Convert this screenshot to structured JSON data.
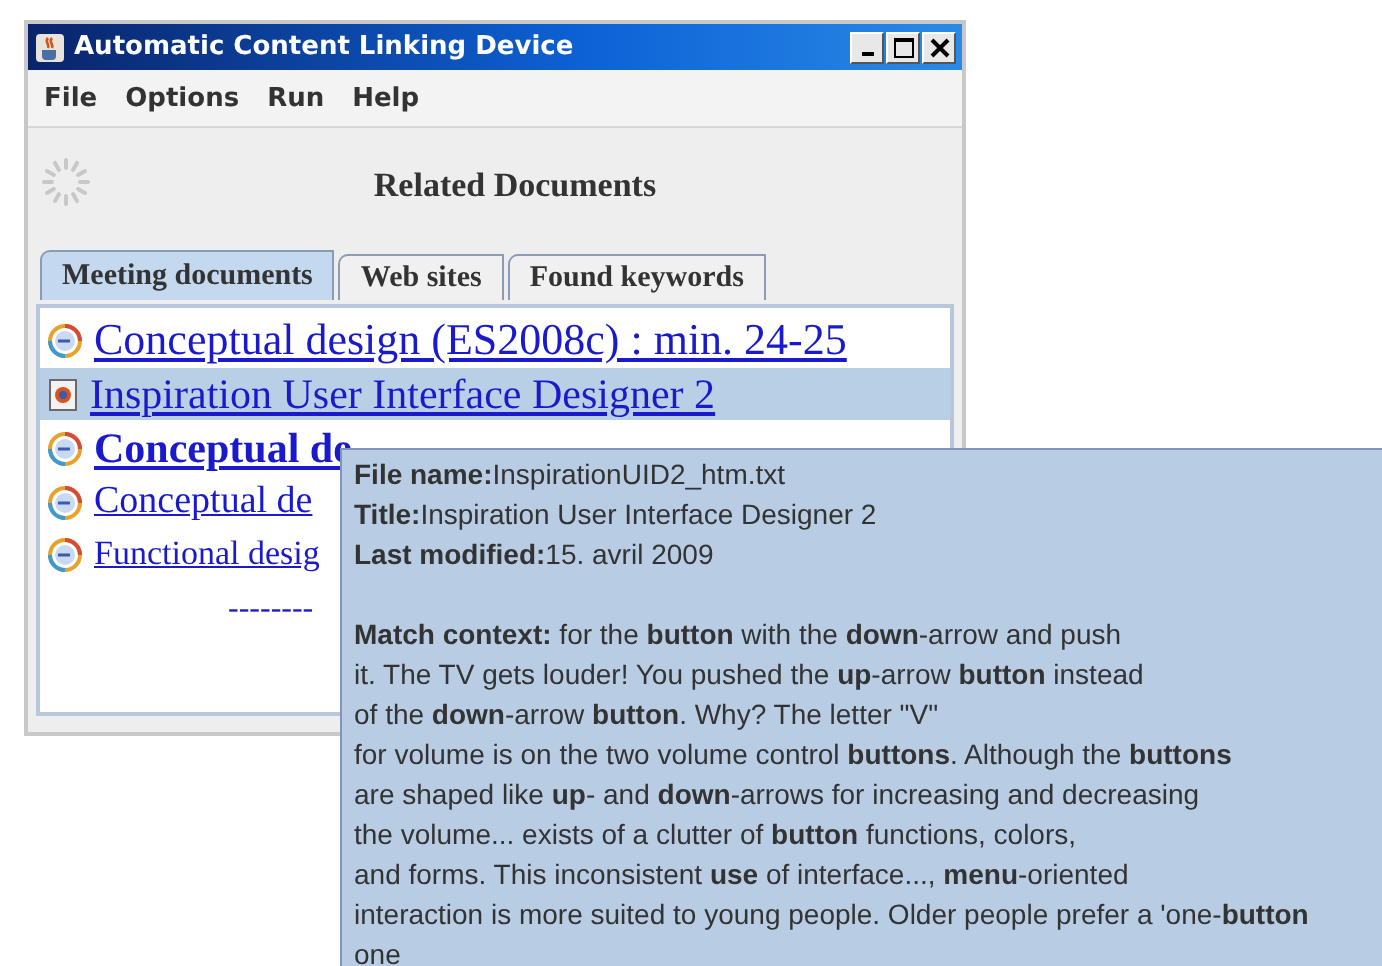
{
  "window": {
    "title": "Automatic Content Linking Device"
  },
  "menu": [
    "File",
    "Options",
    "Run",
    "Help"
  ],
  "heading": "Related Documents",
  "tabs": [
    {
      "label": "Meeting documents",
      "selected": true
    },
    {
      "label": "Web sites",
      "selected": false
    },
    {
      "label": "Found keywords",
      "selected": false
    }
  ],
  "documents": [
    {
      "kind": "meeting",
      "title": "Conceptual design (ES2008c) : min. 24-25",
      "selected": false
    },
    {
      "kind": "document",
      "title": "Inspiration User Interface Designer 2",
      "selected": true
    },
    {
      "kind": "meeting",
      "title": "Conceptual de",
      "selected": false
    },
    {
      "kind": "meeting",
      "title": "Conceptual de",
      "selected": false
    },
    {
      "kind": "meeting",
      "title": "Functional desig",
      "selected": false
    }
  ],
  "separator": "--------",
  "tooltip": {
    "lines": [
      "**File name:**InspirationUID2_htm.txt",
      "**Title:**Inspiration User Interface Designer 2",
      "**Last modified:**15. avril 2009"
    ],
    "context": [
      "**Match context:** for the **button** with the **down**-arrow and push",
      "it. The TV gets louder! You pushed the **up**-arrow **button** instead",
      "of the **down**-arrow **button**. Why? The letter \"V\"",
      "for volume is on the two volume control **buttons**. Although the **buttons**",
      "are shaped like **up**- and **down**-arrows for increasing and decreasing",
      "the volume... exists of a clutter of **button** functions, colors,",
      "and forms. This inconsistent **use** of interface..., **menu**-oriented",
      "interaction is more suited to young people. Older people prefer a 'one-**button**",
      "one"
    ]
  }
}
